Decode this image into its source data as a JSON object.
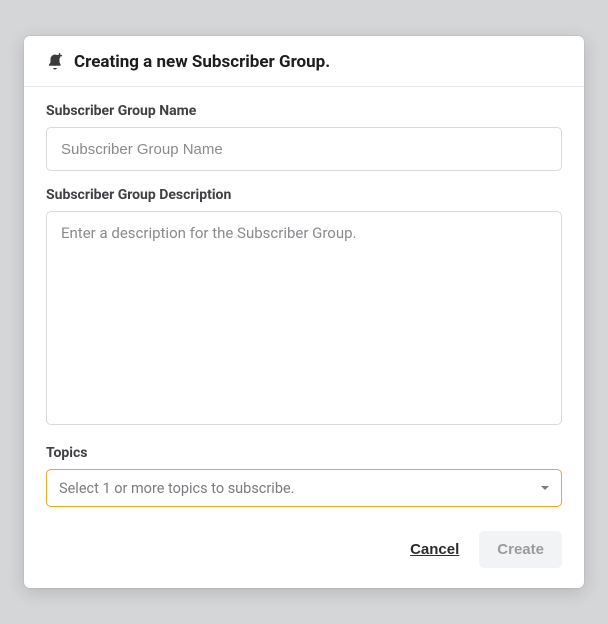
{
  "header": {
    "title": "Creating a new Subscriber Group.",
    "icon": "bell-plus-icon"
  },
  "fields": {
    "name": {
      "label": "Subscriber Group Name",
      "placeholder": "Subscriber Group Name",
      "value": ""
    },
    "description": {
      "label": "Subscriber Group Description",
      "placeholder": "Enter a description for the Subscriber Group.",
      "value": ""
    },
    "topics": {
      "label": "Topics",
      "placeholder": "Select 1 or more topics to subscribe.",
      "selected": ""
    }
  },
  "actions": {
    "cancel_label": "Cancel",
    "create_label": "Create",
    "create_enabled": false
  }
}
